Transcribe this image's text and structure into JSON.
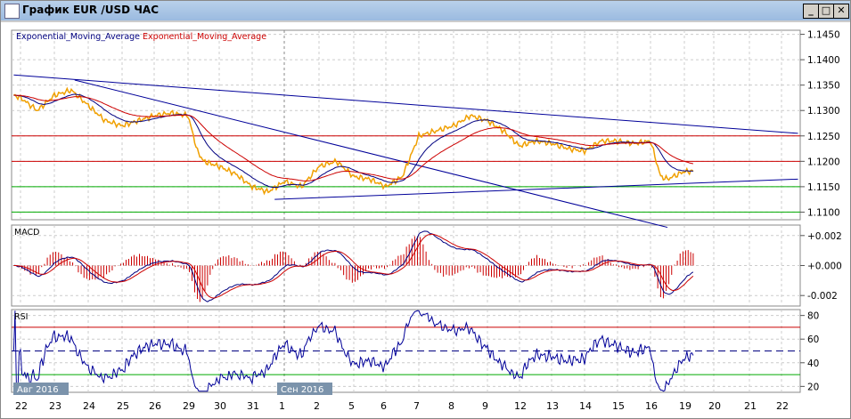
{
  "window": {
    "title": "График EUR /USD  ЧАС",
    "minimize": "_",
    "maximize": "□",
    "close": "✕"
  },
  "legend": {
    "ema_fast": "Exponential_Moving_Average",
    "ema_slow": "Exponential_Moving_Average"
  },
  "colors": {
    "price": "#f0a000",
    "ema_fast": "#000080",
    "ema_slow": "#cc0000",
    "trend": "#000099",
    "resistance": "#cc0000",
    "support": "#00aa00"
  },
  "panels": {
    "macd_label": "MACD",
    "rsi_label": "RSI"
  },
  "month_labels": [
    {
      "label": "Авг 2016",
      "day_index": 0
    },
    {
      "label": "Сен 2016",
      "day_index": 8
    }
  ],
  "chart_data": {
    "type": "line",
    "x_labels": [
      "22",
      "23",
      "24",
      "25",
      "26",
      "29",
      "30",
      "31",
      "1",
      "2",
      "5",
      "6",
      "7",
      "8",
      "9",
      "12",
      "13",
      "14",
      "15",
      "16",
      "19",
      "20",
      "21",
      "22"
    ],
    "price_axis": {
      "ticks": [
        "1.1450",
        "1.1400",
        "1.1350",
        "1.1300",
        "1.1250",
        "1.1200",
        "1.1150",
        "1.1100"
      ],
      "range": [
        1.1085,
        1.1458
      ]
    },
    "macd_axis": {
      "ticks": [
        "+0.002",
        "+0.000",
        "-0.002"
      ],
      "range": [
        -0.0027,
        0.0027
      ]
    },
    "rsi_axis": {
      "ticks": [
        "80",
        "60",
        "40",
        "20"
      ],
      "range": [
        15,
        85
      ]
    },
    "price": {
      "x": [
        -0.2,
        0,
        0.5,
        1,
        1.5,
        2,
        2.5,
        3,
        3.5,
        4,
        4.5,
        5,
        5.3,
        5.5,
        6,
        6.5,
        7,
        7.5,
        8,
        8.5,
        9,
        9.5,
        10,
        10.5,
        11,
        11.5,
        12,
        12.5,
        13,
        13.5,
        14,
        14.5,
        15,
        15.5,
        16,
        16.5,
        17,
        17.5,
        18,
        18.5,
        19,
        19.3,
        19.5,
        20,
        20.3
      ],
      "y": [
        1.133,
        1.1325,
        1.13,
        1.133,
        1.134,
        1.131,
        1.128,
        1.127,
        1.128,
        1.129,
        1.1295,
        1.129,
        1.122,
        1.12,
        1.119,
        1.1175,
        1.115,
        1.114,
        1.116,
        1.115,
        1.119,
        1.12,
        1.117,
        1.1165,
        1.115,
        1.117,
        1.125,
        1.126,
        1.127,
        1.129,
        1.128,
        1.126,
        1.123,
        1.124,
        1.1235,
        1.1225,
        1.122,
        1.124,
        1.124,
        1.1235,
        1.124,
        1.117,
        1.1165,
        1.118,
        1.118
      ]
    },
    "horizontal_levels": [
      {
        "value": 1.125,
        "kind": "resistance"
      },
      {
        "value": 1.12,
        "kind": "resistance"
      },
      {
        "value": 1.115,
        "kind": "support"
      },
      {
        "value": 1.11,
        "kind": "support"
      }
    ],
    "trend_lines": [
      {
        "x1": -0.2,
        "y1": 1.137,
        "x2": 23.5,
        "y2": 1.1255
      },
      {
        "x1": 1.6,
        "y1": 1.136,
        "x2": 19.5,
        "y2": 1.107
      },
      {
        "x1": 7.7,
        "y1": 1.1125,
        "x2": 23.5,
        "y2": 1.1165
      }
    ],
    "rsi_levels": [
      70,
      50,
      30
    ]
  }
}
